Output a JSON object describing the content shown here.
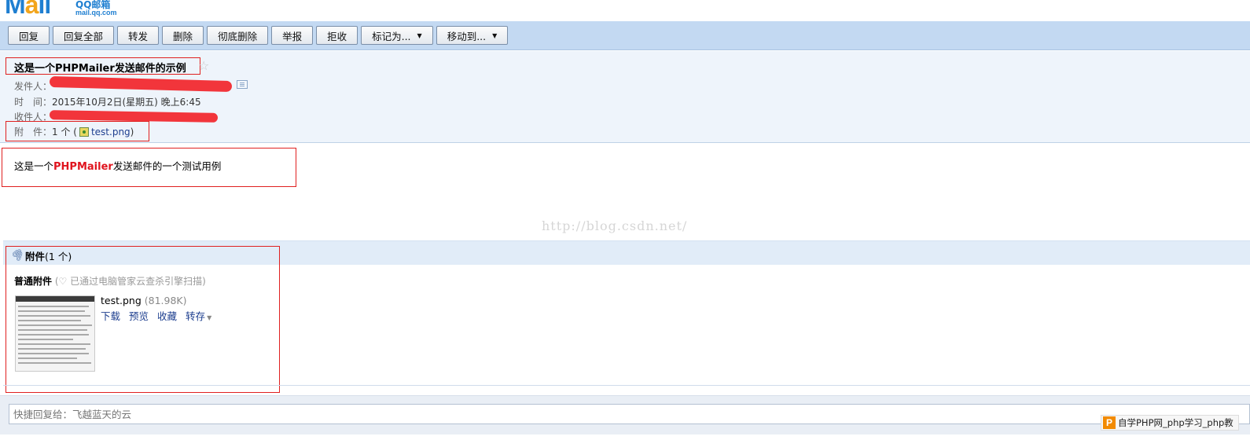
{
  "logo": {
    "mark": "Mail",
    "name_cn": "QQ邮箱",
    "url": "mail.qq.com"
  },
  "toolbar": {
    "buttons": [
      "回复",
      "回复全部",
      "转发",
      "删除",
      "彻底删除",
      "举报",
      "拒收",
      "标记为...",
      "移动到..."
    ]
  },
  "header": {
    "subject": "这是一个PHPMailer发送邮件的示例",
    "sender_label": "发件人：",
    "time_label": "时　间：",
    "time_value": "2015年10月2日(星期五) 晚上6:45",
    "recipient_label": "收件人：",
    "attachment_label": "附　件：",
    "attachment_count": "1 个 (",
    "attachment_file": "test.png",
    "attachment_close": ")"
  },
  "body": {
    "prefix": "这是一个",
    "highlight": "PHPMailer",
    "suffix": "发送邮件的一个测试用例"
  },
  "watermark": "http://blog.csdn.net/",
  "attachments": {
    "title": "附件",
    "count": "(1 个)",
    "normal_label": "普通附件",
    "scan_note": "(♡ 已通过电脑管家云查杀引擎扫描)",
    "file": {
      "name": "test.png",
      "size": "(81.98K)"
    },
    "actions": [
      "下载",
      "预览",
      "收藏",
      "转存"
    ]
  },
  "quick_reply": {
    "placeholder": "快捷回复给：飞越蓝天的云"
  },
  "brand_tag": {
    "icon": "P",
    "text": "自学PHP网_php学习_php教"
  },
  "colors": {
    "toolbar_bg": "#c3d9f2",
    "header_bg": "#eef4fb",
    "highlight_red": "#e0141e",
    "annotation_red": "#e02020"
  }
}
